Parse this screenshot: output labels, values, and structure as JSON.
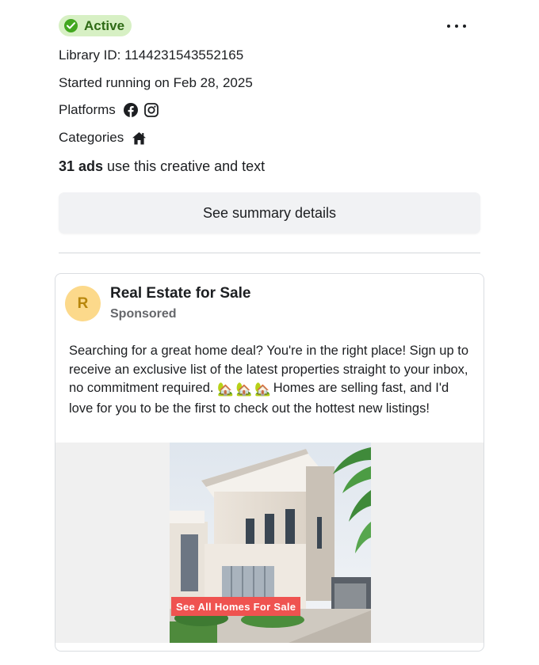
{
  "status": {
    "label": "Active",
    "color": "#42a71f"
  },
  "library_id": "Library ID: 1144231543552165",
  "started": "Started running on Feb 28, 2025",
  "platforms": {
    "label": "Platforms",
    "icons": [
      "facebook-icon",
      "instagram-icon"
    ]
  },
  "categories": {
    "label": "Categories",
    "icons": [
      "home-icon"
    ]
  },
  "ads_count": {
    "count": "31 ads",
    "rest": " use this creative and text"
  },
  "summary_button": "See summary details",
  "ad": {
    "avatar_letter": "R",
    "page_name": "Real Estate for Sale",
    "sponsored": "Sponsored",
    "body_before": "Searching for a great home deal? You're in the right place! Sign up to receive an exclusive list of the latest properties straight to your inbox, no commitment required. ",
    "emoji": [
      "🏡",
      "🏡",
      "🏡"
    ],
    "body_after": "Homes are selling fast, and I'd love for you to be the first to check out the hottest new listings!",
    "cta_banner": "See All Homes For Sale"
  }
}
